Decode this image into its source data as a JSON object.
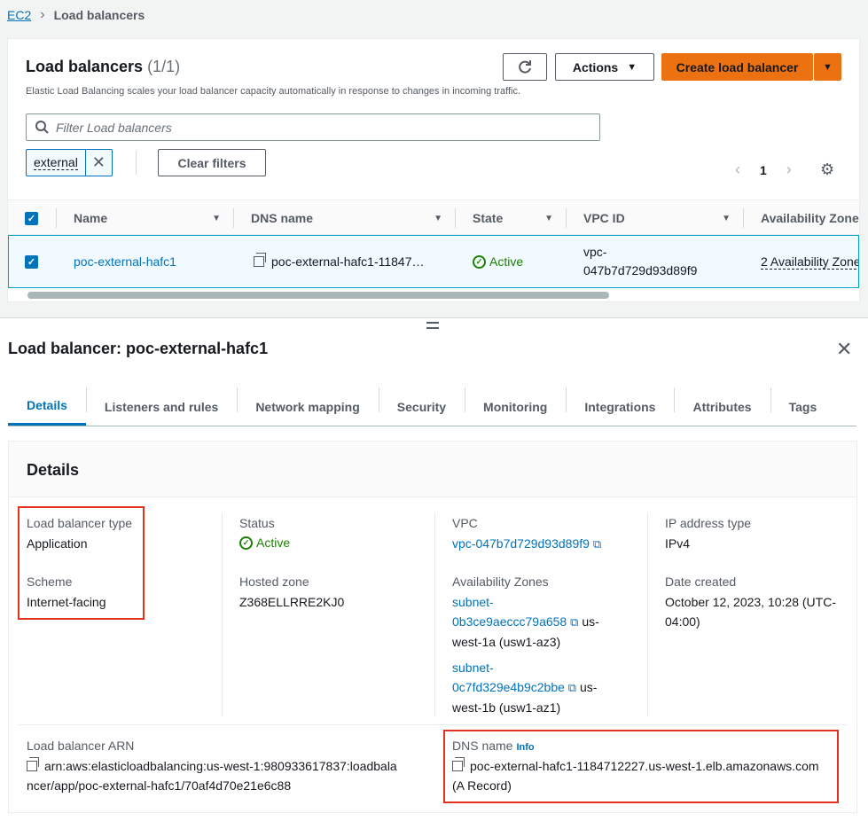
{
  "breadcrumb": {
    "root": "EC2",
    "current": "Load balancers"
  },
  "list": {
    "title": "Load balancers",
    "count": "(1/1)",
    "description": "Elastic Load Balancing scales your load balancer capacity automatically in response to changes in incoming traffic.",
    "actions_label": "Actions",
    "create_label": "Create load balancer",
    "filter_placeholder": "Filter Load balancers",
    "filter_token": "external",
    "clear_filters_label": "Clear filters",
    "page": "1",
    "columns": [
      "Name",
      "DNS name",
      "State",
      "VPC ID",
      "Availability Zone"
    ],
    "row": {
      "name": "poc-external-hafc1",
      "dns": "poc-external-hafc1-11847…",
      "state": "Active",
      "vpc_line1": "vpc-",
      "vpc_line2": "047b7d729d93d89f9",
      "az": "2 Availability Zone"
    }
  },
  "detail": {
    "title": "Load balancer: poc-external-hafc1",
    "tabs": [
      "Details",
      "Listeners and rules",
      "Network mapping",
      "Security",
      "Monitoring",
      "Integrations",
      "Attributes",
      "Tags"
    ],
    "section_title": "Details",
    "lb_type_label": "Load balancer type",
    "lb_type_value": "Application",
    "scheme_label": "Scheme",
    "scheme_value": "Internet-facing",
    "status_label": "Status",
    "status_value": "Active",
    "hosted_zone_label": "Hosted zone",
    "hosted_zone_value": "Z368ELLRRE2KJ0",
    "vpc_label": "VPC",
    "vpc_value": "vpc-047b7d729d93d89f9",
    "az_label": "Availability Zones",
    "subnet1_a": "subnet-",
    "subnet1_b": "0b3ce9aeccc79a658",
    "subnet1_suffix": "us-",
    "subnet1_zone": "west-1a (usw1-az3)",
    "subnet2_a": "subnet-",
    "subnet2_b": "0c7fd329e4b9c2bbe",
    "subnet2_suffix": "us-",
    "subnet2_zone": "west-1b (usw1-az1)",
    "ip_type_label": "IP address type",
    "ip_type_value": "IPv4",
    "date_label": "Date created",
    "date_line1": "October 12, 2023, 10:28 (UTC-",
    "date_line2": "04:00)",
    "arn_label": "Load balancer ARN",
    "arn_line1": "arn:aws:elasticloadbalancing:us-west-1:980933617837:loadbala",
    "arn_line2": "ncer/app/poc-external-hafc1/70af4d70e21e6c88",
    "dns_label": "DNS name",
    "dns_info": "Info",
    "dns_value": "poc-external-hafc1-1184712227.us-west-1.elb.amazonaws.com",
    "dns_record": "(A Record)"
  },
  "colors": {
    "accent": "#0073bb",
    "primary": "#ec7211",
    "success": "#1d8102",
    "highlight": "#e0321c"
  }
}
